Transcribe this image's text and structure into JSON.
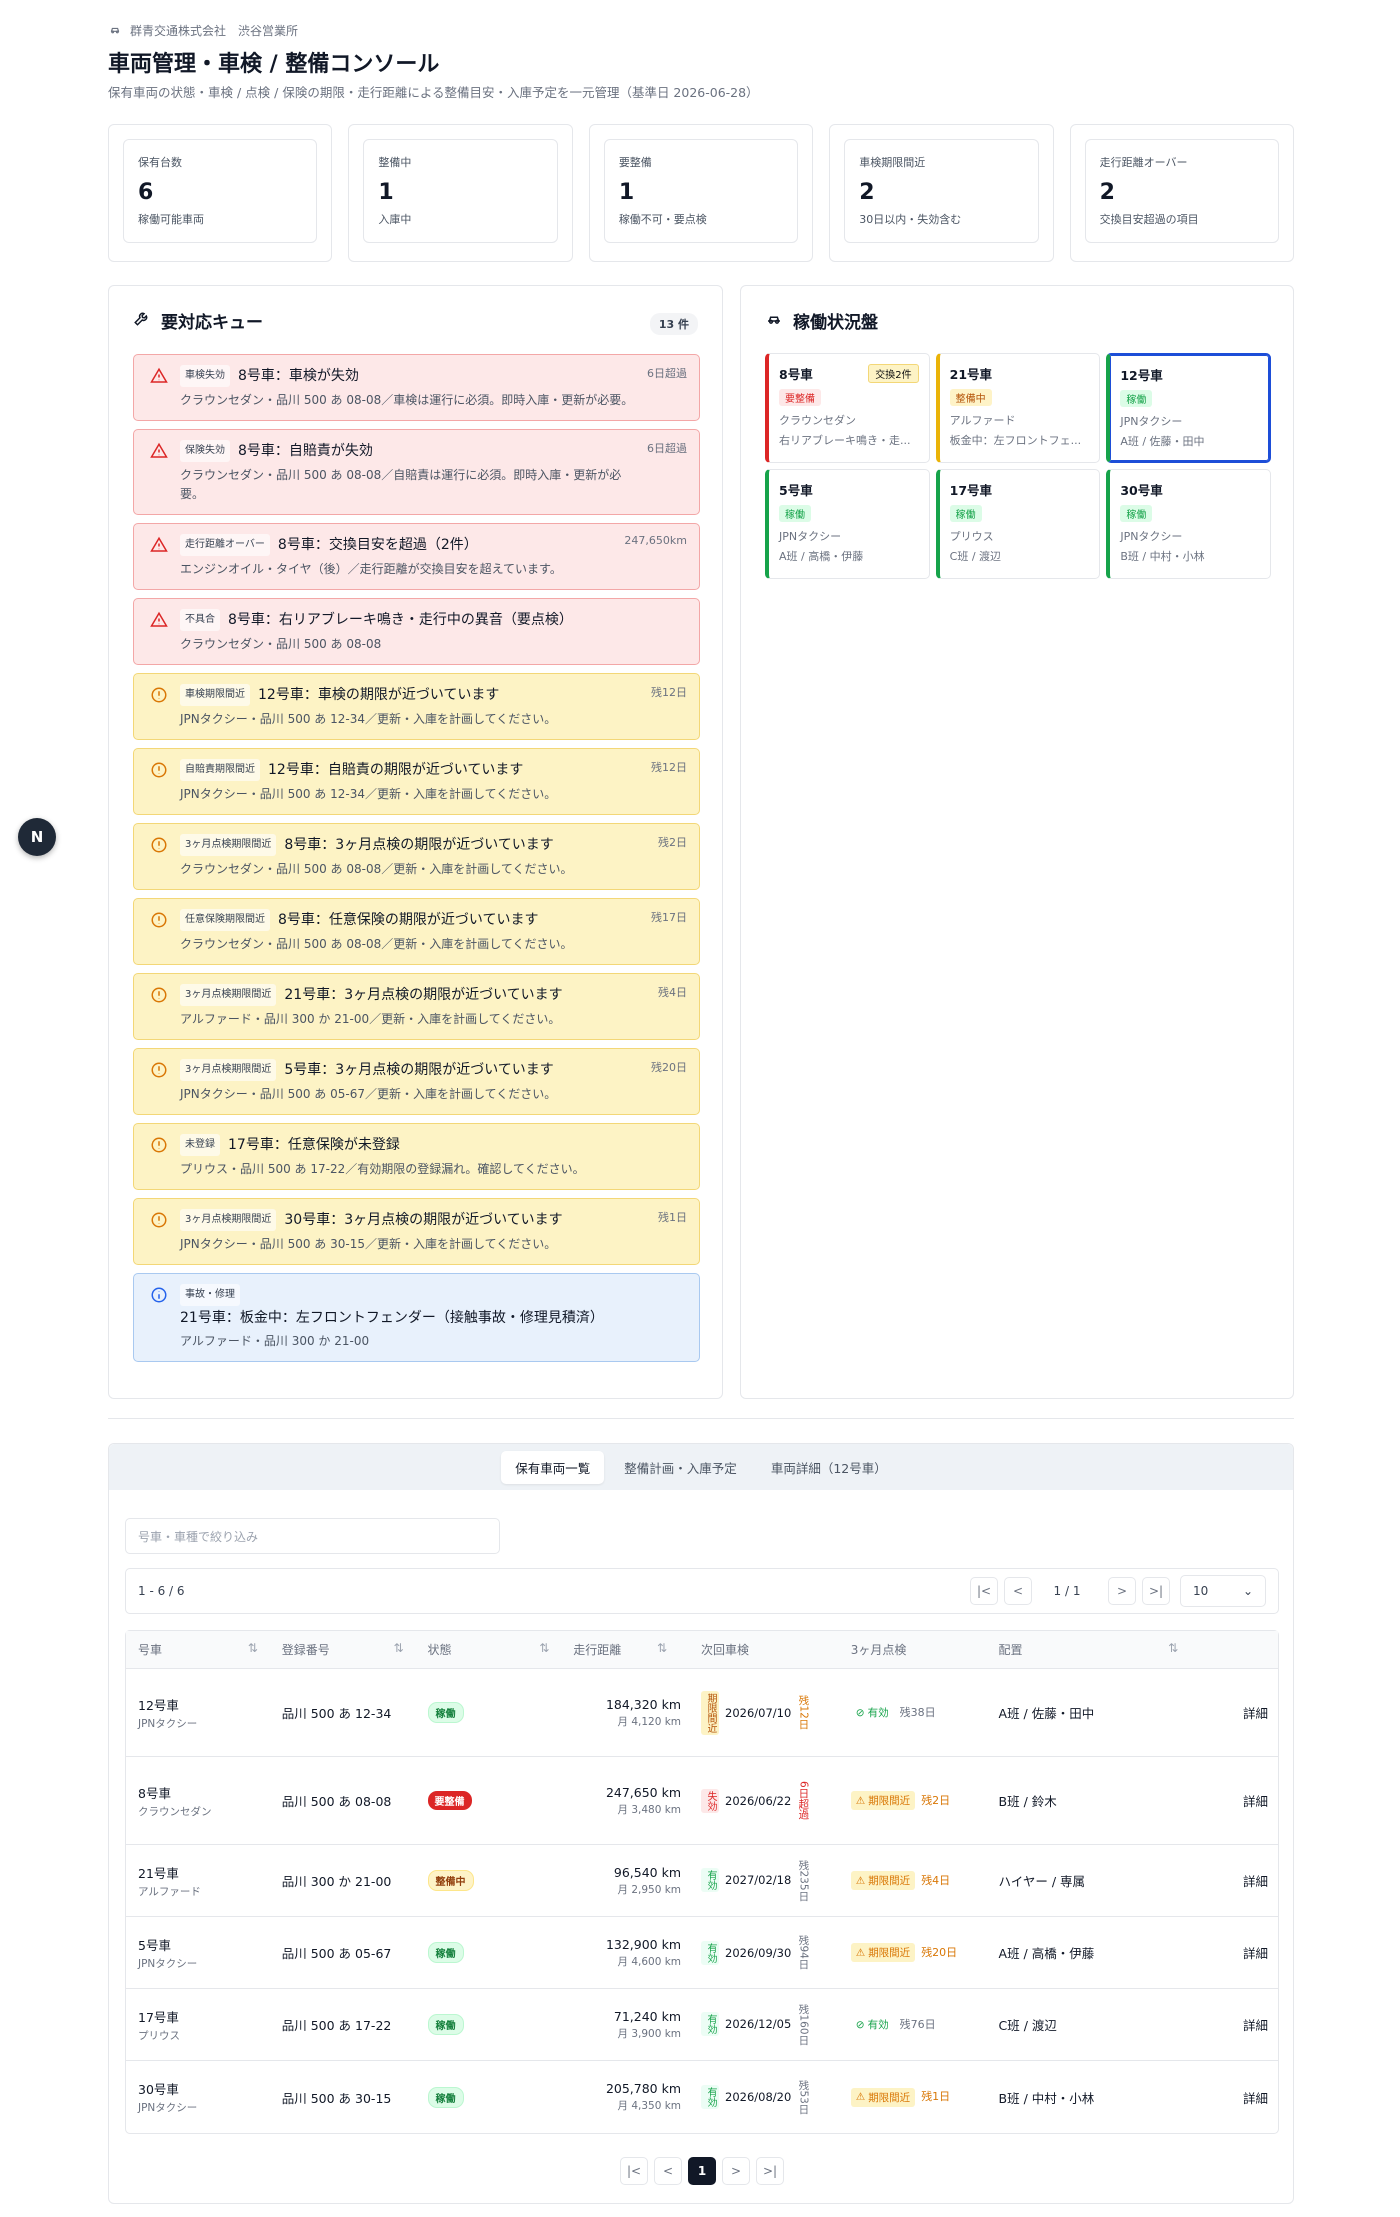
{
  "header": {
    "company": "群青交通株式会社　渋谷営業所",
    "title": "車両管理・車検 / 整備コンソール",
    "subtitle": "保有車両の状態・車検 / 点検 / 保険の期限・走行距離による整備目安・入庫予定を一元管理（基準日 2026-06-28）"
  },
  "stats": [
    {
      "label": "保有台数",
      "value": "6",
      "note": "稼働可能車両"
    },
    {
      "label": "整備中",
      "value": "1",
      "note": "入庫中"
    },
    {
      "label": "要整備",
      "value": "1",
      "note": "稼働不可・要点検"
    },
    {
      "label": "車検期限間近",
      "value": "2",
      "note": "30日以内・失効含む"
    },
    {
      "label": "走行距離オーバー",
      "value": "2",
      "note": "交換目安超過の項目"
    }
  ],
  "queue": {
    "title": "要対応キュー",
    "count": "13 件",
    "items": [
      {
        "level": "red",
        "tag": "車検失効",
        "title": "8号車：車検が失効",
        "desc": "クラウンセダン・品川 500 あ 08-08／車検は運行に必須。即時入庫・更新が必要。",
        "due": "6日超過"
      },
      {
        "level": "red",
        "tag": "保険失効",
        "title": "8号車：自賠責が失効",
        "desc": "クラウンセダン・品川 500 あ 08-08／自賠責は運行に必須。即時入庫・更新が必要。",
        "due": "6日超過"
      },
      {
        "level": "red",
        "tag": "走行距離オーバー",
        "title": "8号車：交換目安を超過（2件）",
        "desc": "エンジンオイル・タイヤ（後）／走行距離が交換目安を超えています。",
        "due": "247,650km"
      },
      {
        "level": "red",
        "tag": "不具合",
        "title": "8号車：右リアブレーキ鳴き・走行中の異音（要点検）",
        "desc": "クラウンセダン・品川 500 あ 08-08",
        "due": ""
      },
      {
        "level": "yel",
        "tag": "車検期限間近",
        "title": "12号車：車検の期限が近づいています",
        "desc": "JPNタクシー・品川 500 あ 12-34／更新・入庫を計画してください。",
        "due": "残12日"
      },
      {
        "level": "yel",
        "tag": "自賠責期限間近",
        "title": "12号車：自賠責の期限が近づいています",
        "desc": "JPNタクシー・品川 500 あ 12-34／更新・入庫を計画してください。",
        "due": "残12日"
      },
      {
        "level": "yel",
        "tag": "3ヶ月点検期限間近",
        "title": "8号車：3ヶ月点検の期限が近づいています",
        "desc": "クラウンセダン・品川 500 あ 08-08／更新・入庫を計画してください。",
        "due": "残2日"
      },
      {
        "level": "yel",
        "tag": "任意保険期限間近",
        "title": "8号車：任意保険の期限が近づいています",
        "desc": "クラウンセダン・品川 500 あ 08-08／更新・入庫を計画してください。",
        "due": "残17日"
      },
      {
        "level": "yel",
        "tag": "3ヶ月点検期限間近",
        "title": "21号車：3ヶ月点検の期限が近づいています",
        "desc": "アルファード・品川 300 か 21-00／更新・入庫を計画してください。",
        "due": "残4日"
      },
      {
        "level": "yel",
        "tag": "3ヶ月点検期限間近",
        "title": "5号車：3ヶ月点検の期限が近づいています",
        "desc": "JPNタクシー・品川 500 あ 05-67／更新・入庫を計画してください。",
        "due": "残20日"
      },
      {
        "level": "yel",
        "tag": "未登録",
        "title": "17号車：任意保険が未登録",
        "desc": "プリウス・品川 500 あ 17-22／有効期限の登録漏れ。確認してください。",
        "due": ""
      },
      {
        "level": "yel",
        "tag": "3ヶ月点検期限間近",
        "title": "30号車：3ヶ月点検の期限が近づいています",
        "desc": "JPNタクシー・品川 500 あ 30-15／更新・入庫を計画してください。",
        "due": "残1日"
      },
      {
        "level": "blu",
        "tag": "事故・修理",
        "title": "21号車：板金中：左フロントフェンダー（接触事故・修理見積済）",
        "desc": "アルファード・品川 300 か 21-00",
        "due": ""
      }
    ]
  },
  "board": {
    "title": "稼働状況盤",
    "cards": [
      {
        "no": "8号車",
        "status": "要整備",
        "stype": "bad",
        "kind": "クラウンセダン",
        "sub": "右リアブレーキ鳴き・走...",
        "badge": "交換2件",
        "color": "#dc2626",
        "selected": false
      },
      {
        "no": "21号車",
        "status": "整備中",
        "stype": "mnt",
        "kind": "アルファード",
        "sub": "板金中：左フロントフェ...",
        "badge": "",
        "color": "#eab308",
        "selected": false
      },
      {
        "no": "12号車",
        "status": "稼働",
        "stype": "ok",
        "kind": "JPNタクシー",
        "sub": "A班 / 佐藤・田中",
        "badge": "",
        "color": "#16a34a",
        "selected": true
      },
      {
        "no": "5号車",
        "status": "稼働",
        "stype": "ok",
        "kind": "JPNタクシー",
        "sub": "A班 / 高橋・伊藤",
        "badge": "",
        "color": "#16a34a",
        "selected": false
      },
      {
        "no": "17号車",
        "status": "稼働",
        "stype": "ok",
        "kind": "プリウス",
        "sub": "C班 / 渡辺",
        "badge": "",
        "color": "#16a34a",
        "selected": false
      },
      {
        "no": "30号車",
        "status": "稼働",
        "stype": "ok",
        "kind": "JPNタクシー",
        "sub": "B班 / 中村・小林",
        "badge": "",
        "color": "#16a34a",
        "selected": false
      }
    ]
  },
  "tabs": [
    "保有車両一覧",
    "整備計画・入庫予定",
    "車両詳細（12号車）"
  ],
  "filter": {
    "placeholder": "号車・車種で絞り込み"
  },
  "pager": {
    "range": "1 - 6 / 6",
    "page": "1 / 1",
    "size": "10"
  },
  "table": {
    "headers": [
      "号車",
      "登録番号",
      "状態",
      "走行距離",
      "次回車検",
      "3ヶ月点検",
      "配置",
      ""
    ],
    "rows": [
      {
        "no": "12号車",
        "kind": "JPNタクシー",
        "plate": "品川 500 あ 12-34",
        "status": "稼働",
        "stype": "ok",
        "km": "184,320 km",
        "monthly": "月 4,120 km",
        "itag": "期限間近",
        "itype": "warn",
        "idate": "2026/07/10",
        "irem": "残12日",
        "iremtype": "warn",
        "mtag": "有効",
        "mtype": "ok",
        "mrem": "残38日",
        "assign": "A班 / 佐藤・田中",
        "action": "詳細",
        "h": 88
      },
      {
        "no": "8号車",
        "kind": "クラウンセダン",
        "plate": "品川 500 あ 08-08",
        "status": "要整備",
        "stype": "bad",
        "km": "247,650 km",
        "monthly": "月 3,480 km",
        "itag": "失効",
        "itype": "bad",
        "idate": "2026/06/22",
        "irem": "6日超過",
        "iremtype": "red",
        "mtag": "期限間近",
        "mtype": "warn",
        "mrem": "残2日",
        "assign": "B班 / 鈴木",
        "action": "詳細",
        "h": 88
      },
      {
        "no": "21号車",
        "kind": "アルファード",
        "plate": "品川 300 か 21-00",
        "status": "整備中",
        "stype": "mnt",
        "km": "96,540 km",
        "monthly": "月 2,950 km",
        "itag": "有効",
        "itype": "ok",
        "idate": "2027/02/18",
        "irem": "残235日",
        "iremtype": "",
        "mtag": "期限間近",
        "mtype": "warn",
        "mrem": "残4日",
        "assign": "ハイヤー / 専属",
        "action": "詳細",
        "h": 72
      },
      {
        "no": "5号車",
        "kind": "JPNタクシー",
        "plate": "品川 500 あ 05-67",
        "status": "稼働",
        "stype": "ok",
        "km": "132,900 km",
        "monthly": "月 4,600 km",
        "itag": "有効",
        "itype": "ok",
        "idate": "2026/09/30",
        "irem": "残94日",
        "iremtype": "",
        "mtag": "期限間近",
        "mtype": "warn",
        "mrem": "残20日",
        "assign": "A班 / 高橋・伊藤",
        "action": "詳細",
        "h": 72
      },
      {
        "no": "17号車",
        "kind": "プリウス",
        "plate": "品川 500 あ 17-22",
        "status": "稼働",
        "stype": "ok",
        "km": "71,240 km",
        "monthly": "月 3,900 km",
        "itag": "有効",
        "itype": "ok",
        "idate": "2026/12/05",
        "irem": "残160日",
        "iremtype": "",
        "mtag": "有効",
        "mtype": "ok",
        "mrem": "残76日",
        "assign": "C班 / 渡辺",
        "action": "詳細",
        "h": 72
      },
      {
        "no": "30号車",
        "kind": "JPNタクシー",
        "plate": "品川 500 あ 30-15",
        "status": "稼働",
        "stype": "ok",
        "km": "205,780 km",
        "monthly": "月 4,350 km",
        "itag": "有効",
        "itype": "ok",
        "idate": "2026/08/20",
        "irem": "残53日",
        "iremtype": "",
        "mtag": "期限間近",
        "mtype": "warn",
        "mrem": "残1日",
        "assign": "B班 / 中村・小林",
        "action": "詳細",
        "h": 72
      }
    ]
  },
  "bottom_pager": {
    "current": "1"
  },
  "overlay": {
    "letter": "N"
  }
}
